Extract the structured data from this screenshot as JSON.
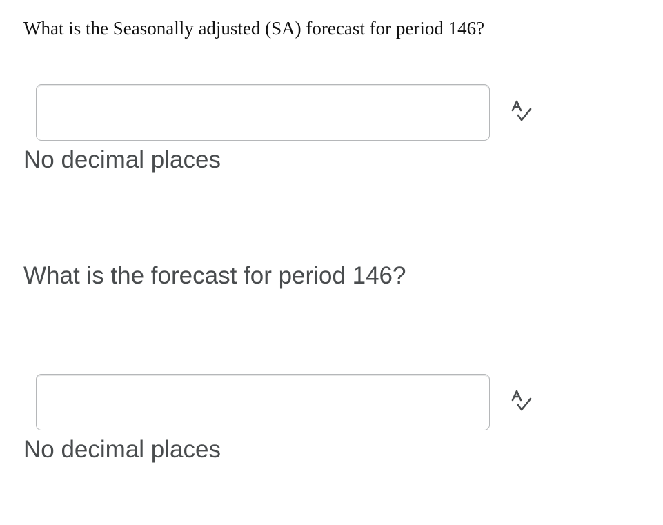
{
  "questions": [
    {
      "prompt": "What is the Seasonally adjusted (SA) forecast for period 146?",
      "answer_value": "",
      "hint": "No decimal places",
      "spellcheck_icon": "spellcheck-icon"
    },
    {
      "prompt": "What is the forecast for period 146?",
      "answer_value": "",
      "hint": "No decimal places",
      "spellcheck_icon": "spellcheck-icon"
    }
  ],
  "colors": {
    "primary_text": "#111111",
    "secondary_text": "#494c4e",
    "input_border": "#b5b7b9",
    "icon": "#494c4e"
  }
}
